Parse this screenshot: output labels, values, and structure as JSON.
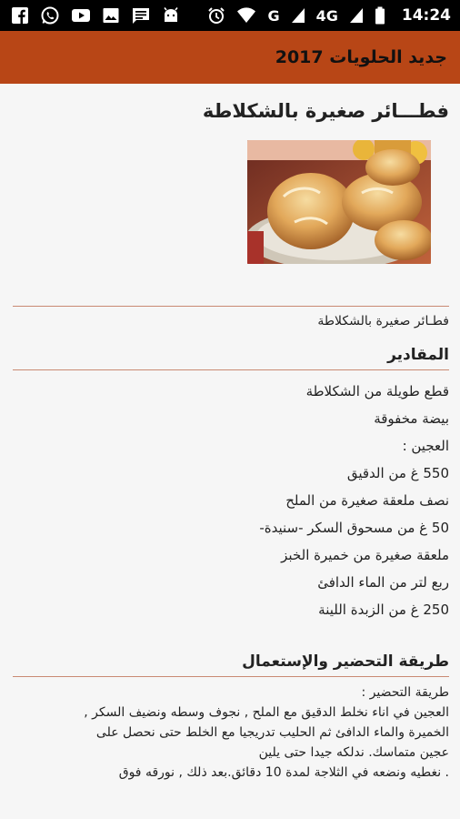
{
  "status_bar": {
    "time": "14:24",
    "network": "4G",
    "signal_letter": "G"
  },
  "app_bar": {
    "title": "جديد الحلويات 2017"
  },
  "recipe": {
    "title": "فطـــائر صغيرة بالشكلاطة",
    "subtitle": "فطـائر صغيرة بالشكلاطة",
    "ingredients_heading": "المقادير",
    "ingredients": [
      "قطع طويلة من الشكلاطة",
      "بيضة مخفوقة",
      "العجين :",
      "550 غ من الدقيق",
      "نصف ملعقة صغيرة من الملح",
      "50 غ من مسحوق السكر -سنيدة-",
      "ملعقة صغيرة من خميرة الخبز",
      "ربع لتر من الماء الدافئ",
      "250 غ من الزبدة اللينة"
    ],
    "preparation_heading": "طريقة التحضير والإستعمال",
    "preparation_lines": [
      "طريقة التحضير :",
      "العجين في اناء نخلط الدقيق مع الملح , نجوف وسطه ونضيف السكر ,",
      "الخميرة والماء الدافئ ثم الحليب تدريجيا مع الخلط حتى نحصل على",
      "عجين متماسك. ندلكه جيدا حتى يلين",
      ". نغطيه ونضعه في الثلاجة لمدة 10 دقائق.بعد ذلك , نورقه فوق"
    ]
  },
  "colors": {
    "app_bar": "#b84616",
    "divider": "#c98a73",
    "background": "#f6f6f6"
  },
  "icons": [
    "facebook-icon",
    "whatsapp-icon",
    "youtube-icon",
    "image-icon",
    "chat-icon",
    "android-icon",
    "alarm-icon",
    "wifi-icon",
    "signal-icon",
    "battery-icon"
  ]
}
